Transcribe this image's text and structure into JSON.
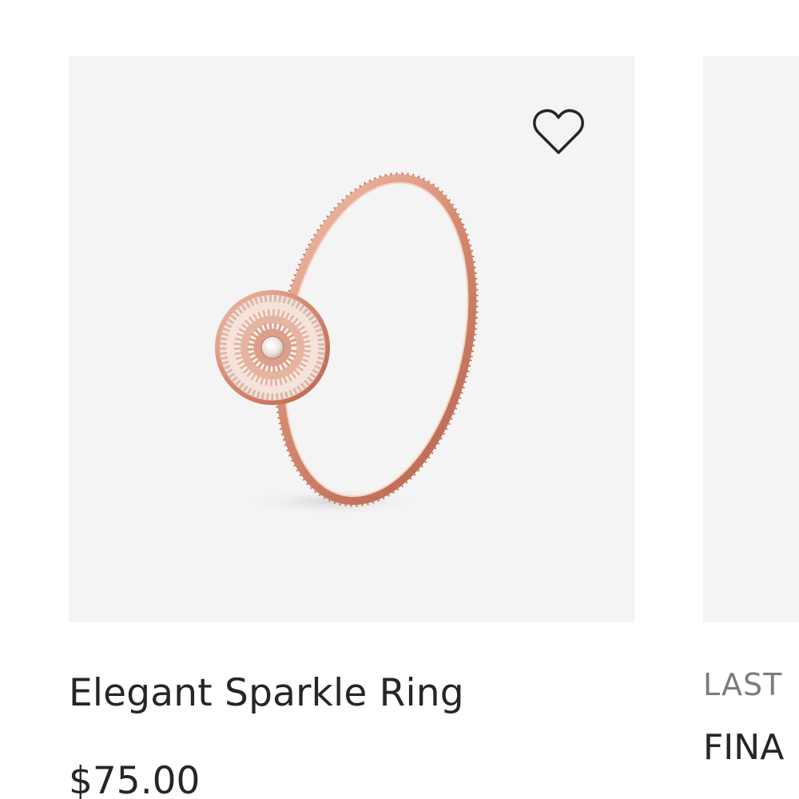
{
  "products": [
    {
      "name": "Elegant Sparkle Ring",
      "price": "$75.00",
      "wishlist_icon": "heart-outline-icon",
      "image_alt": "rose gold ring with pave halo"
    },
    {
      "badge": "LAST",
      "name": "FINA"
    }
  ],
  "colors": {
    "image_background": "#f4f4f4",
    "text_primary": "#262626",
    "text_secondary": "#7c7c7c",
    "rose_gold": "#e0a08a"
  }
}
